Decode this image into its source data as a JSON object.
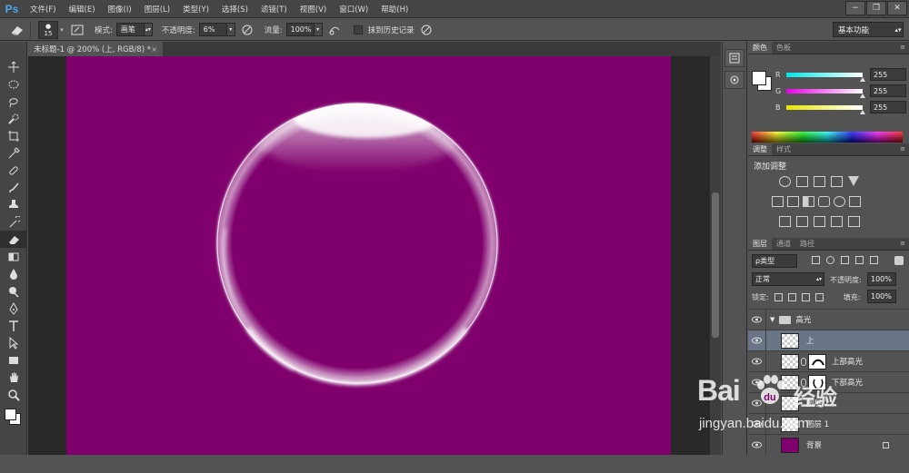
{
  "app": {
    "logo": "Ps"
  },
  "menu": [
    "文件(F)",
    "编辑(E)",
    "图像(I)",
    "图层(L)",
    "类型(Y)",
    "选择(S)",
    "滤镜(T)",
    "视图(V)",
    "窗口(W)",
    "帮助(H)"
  ],
  "window_controls": {
    "minimize": "−",
    "restore": "❐",
    "close": "✕"
  },
  "options": {
    "brush_size": "15",
    "mode_label": "模式:",
    "mode_value": "画笔",
    "opacity_label": "不透明度:",
    "opacity_value": "6%",
    "flow_label": "流量:",
    "flow_value": "100%",
    "history_label": "抹到历史记录",
    "workspace": "基本功能"
  },
  "document_tab": {
    "title": "未标题-1 @ 200% (上, RGB/8) *",
    "close": "×"
  },
  "color_panel": {
    "tabs": [
      "颜色",
      "色板"
    ],
    "channels": [
      {
        "label": "R",
        "value": "255",
        "color": "#00c8d8"
      },
      {
        "label": "G",
        "value": "255",
        "color": "#d800c8"
      },
      {
        "label": "B",
        "value": "255",
        "color": "#e0e000"
      }
    ]
  },
  "adjust_panel": {
    "tabs": [
      "调整",
      "样式"
    ],
    "title": "添加调整"
  },
  "layers_panel": {
    "tabs": [
      "图层",
      "通道",
      "路径"
    ],
    "filter": "ρ类型",
    "blend_mode": "正常",
    "opacity_label": "不透明度:",
    "opacity_value": "100%",
    "lock_label": "锁定:",
    "fill_label": "填充:",
    "fill_value": "100%",
    "layers": [
      {
        "name": "高光",
        "type": "group"
      },
      {
        "name": "上",
        "type": "layer",
        "selected": true
      },
      {
        "name": "上部高光",
        "type": "masked"
      },
      {
        "name": "下部高光",
        "type": "masked"
      },
      {
        "name": "图层 2",
        "type": "layer"
      },
      {
        "name": "图层 1",
        "type": "layer"
      },
      {
        "name": "背景",
        "type": "background"
      }
    ]
  },
  "canvas": {
    "background": "#7f006c"
  },
  "watermark": {
    "brand": "Bai",
    "cn": "经验",
    "url": "jingyan.baidu.com"
  }
}
